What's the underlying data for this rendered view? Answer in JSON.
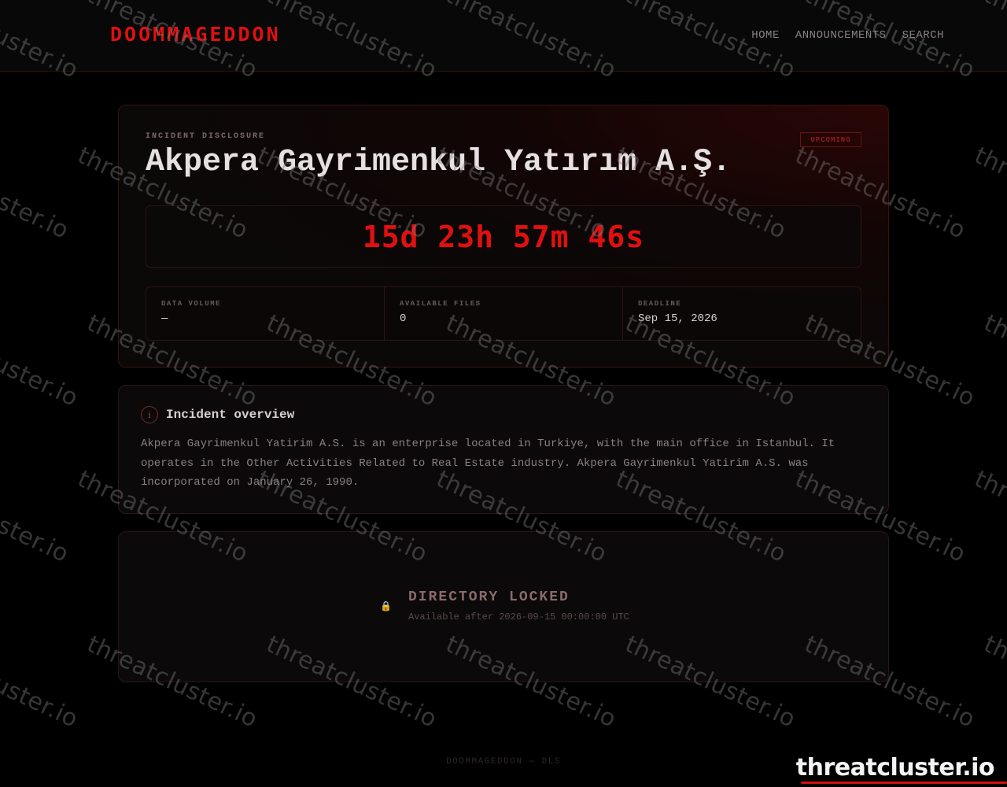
{
  "header": {
    "logo": "DOOMMAGEDDON",
    "nav": [
      "HOME",
      "ANNOUNCEMENTS",
      "SEARCH"
    ]
  },
  "hero": {
    "eyebrow": "INCIDENT DISCLOSURE",
    "badge": "UPCOMING",
    "title": "Akpera Gayrimenkul Yatırım A.Ş.",
    "countdown": "15d 23h 57m 46s",
    "stats": [
      {
        "label": "DATA VOLUME",
        "value": "—"
      },
      {
        "label": "AVAILABLE FILES",
        "value": "0"
      },
      {
        "label": "DEADLINE",
        "value": "Sep 15, 2026"
      }
    ]
  },
  "overview": {
    "title": "Incident overview",
    "text": "Akpera Gayrimenkul Yatirim A.S. is an enterprise located in Turkiye, with the main office in Istanbul. It operates in the Other Activities Related to Real Estate industry. Akpera Gayrimenkul Yatirim A.S. was incorporated on January 26, 1990."
  },
  "locked": {
    "title": "DIRECTORY LOCKED",
    "subtitle": "Available after 2026-09-15 00:00:00 UTC"
  },
  "footer": "DOOMMAGEDDON — DLS",
  "watermark": {
    "text": "threatcluster.io",
    "brand_text": "threatcluster.io"
  },
  "colors": {
    "accent": "#e01010",
    "background": "#000000",
    "card": "#0b0909",
    "border": "#2a1818"
  },
  "icons": {
    "info": "info-icon",
    "lock": "lock-icon"
  }
}
